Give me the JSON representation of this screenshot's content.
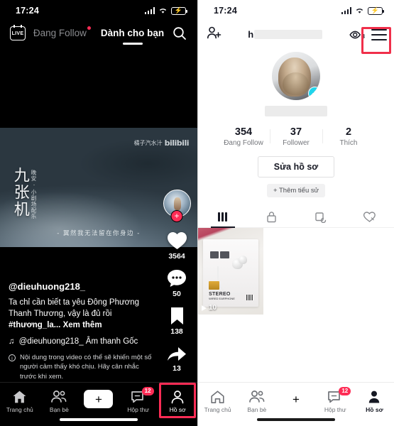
{
  "left": {
    "status": {
      "time": "17:24"
    },
    "header": {
      "live_label": "LIVE",
      "tab_following": "Đang Follow",
      "tab_foryou": "Dành cho bạn",
      "search_icon": "search-icon"
    },
    "video": {
      "cn_title": "九张机",
      "cn_subtitle": "晚安 · 小剧场配乐",
      "watermark_prefix": "橘子汽水汁",
      "watermark_brand": "bilibili",
      "cn_caption": "- 翼然我无法留在你身边 -"
    },
    "rail": {
      "follow_plus": "+",
      "likes": "3564",
      "comments": "50",
      "bookmarks": "138",
      "shares": "13"
    },
    "caption": {
      "handle": "@dieuhuong218_",
      "desc_main": "Ta chỉ cần biết ta yêu Đông Phương Thanh Thương, vậy là đủ rồi ",
      "desc_tag": "#thương_la...",
      "more": "Xem thêm",
      "music_icon": "music-note-icon",
      "music": "@dieuhuong218_  Âm thanh Gốc",
      "warning": "Nội dung trong video có thể sẽ khiến một số người cảm thấy khó chịu. Hãy cân nhắc trước khi xem."
    },
    "nav": {
      "items": [
        {
          "label": "Trang chủ",
          "icon": "home-icon"
        },
        {
          "label": "Bạn bè",
          "icon": "friends-icon"
        },
        {
          "label": "",
          "icon": "create-plus-icon"
        },
        {
          "label": "Hộp thư",
          "icon": "inbox-icon",
          "badge": "12"
        },
        {
          "label": "Hồ sơ",
          "icon": "profile-icon"
        }
      ]
    }
  },
  "right": {
    "status": {
      "time": "17:24"
    },
    "header": {
      "add_friend_icon": "add-person-icon",
      "username_prefix": "h",
      "views_icon": "eye-icon",
      "views_count": "3",
      "menu_icon": "hamburger-menu-icon"
    },
    "profile": {
      "avatar_plus": "+",
      "stats": [
        {
          "num": "354",
          "label": "Đang Follow"
        },
        {
          "num": "37",
          "label": "Follower"
        },
        {
          "num": "2",
          "label": "Thích"
        }
      ],
      "edit_label": "Sửa hồ sơ",
      "add_bio_label": "+ Thêm tiểu sử"
    },
    "tabs": [
      {
        "icon": "grid-icon",
        "active": true
      },
      {
        "icon": "lock-icon",
        "active": false
      },
      {
        "icon": "repost-icon",
        "active": false
      },
      {
        "icon": "liked-heart-icon",
        "active": false
      }
    ],
    "videos": [
      {
        "play_count": "10",
        "brand": "hoco",
        "title": "STEREO",
        "subtitle": "WIRED EARPHONE"
      }
    ],
    "nav": {
      "items": [
        {
          "label": "Trang chủ",
          "icon": "home-icon"
        },
        {
          "label": "Bạn bè",
          "icon": "friends-icon"
        },
        {
          "label": "",
          "icon": "create-plus-icon"
        },
        {
          "label": "Hộp thư",
          "icon": "inbox-icon",
          "badge": "12"
        },
        {
          "label": "Hồ sơ",
          "icon": "profile-icon"
        }
      ]
    }
  },
  "colors": {
    "accent_red": "#fe2c55",
    "accent_cyan": "#25f4ee",
    "highlight_box": "#f02f4a",
    "avatar_plus_cyan": "#20d5ec"
  }
}
